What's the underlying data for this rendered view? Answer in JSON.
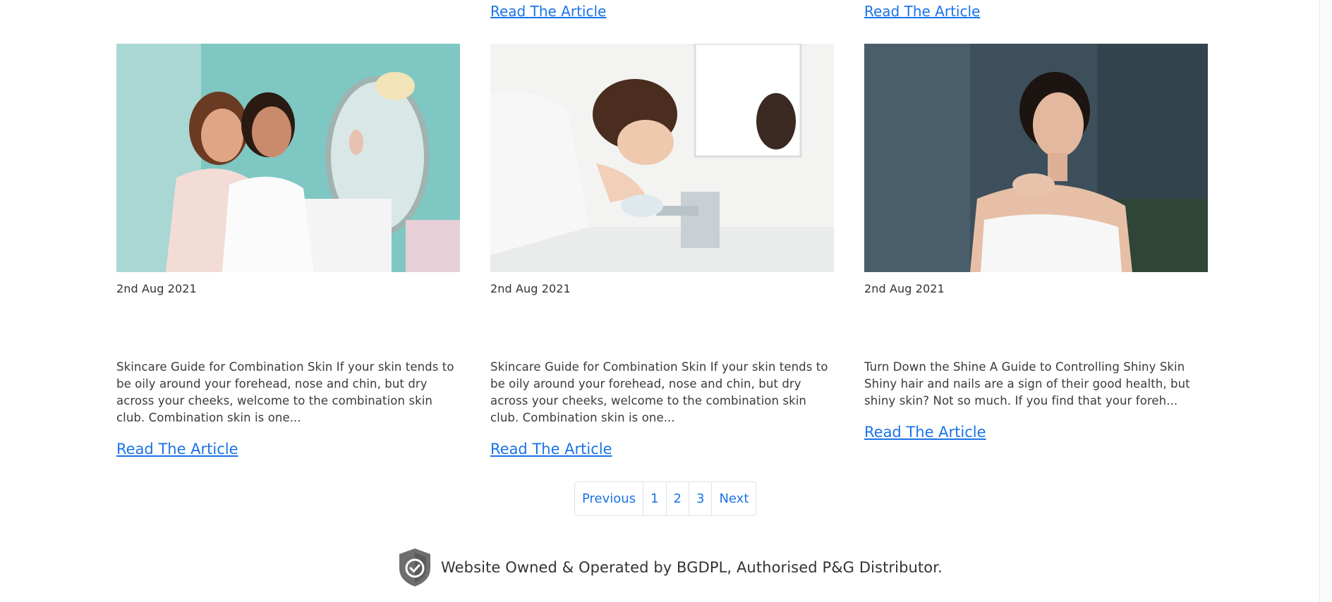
{
  "top_links": {
    "col2": "Read The Article",
    "col3": "Read The Article"
  },
  "cards": [
    {
      "date": "2nd Aug 2021",
      "excerpt": "Skincare Guide for Combination Skin If your skin tends to be oily around your forehead, nose and chin, but dry across your cheeks, welcome to the combination skin club. Combination skin is one...",
      "read_more": "Read The Article"
    },
    {
      "date": "2nd Aug 2021",
      "excerpt": "Skincare Guide for Combination Skin If your skin tends to be oily around your forehead, nose and chin, but dry across your cheeks, welcome to the combination skin club. Combination skin is one...",
      "read_more": "Read The Article"
    },
    {
      "date": "2nd Aug 2021",
      "excerpt": "Turn Down the Shine A Guide to Controlling Shiny Skin Shiny hair and nails are a sign of their good health, but shiny skin? Not so much. If you find that your foreh...",
      "read_more": "Read The Article"
    }
  ],
  "pagination": {
    "previous": "Previous",
    "pages": [
      "1",
      "2",
      "3"
    ],
    "next": "Next"
  },
  "footer": {
    "text": "Website Owned & Operated by BGDPL, Authorised P&G Distributor.",
    "icon": "shield-check-icon"
  },
  "colors": {
    "link": "#1a73e8",
    "text": "#333333",
    "border": "#dee2e6"
  }
}
